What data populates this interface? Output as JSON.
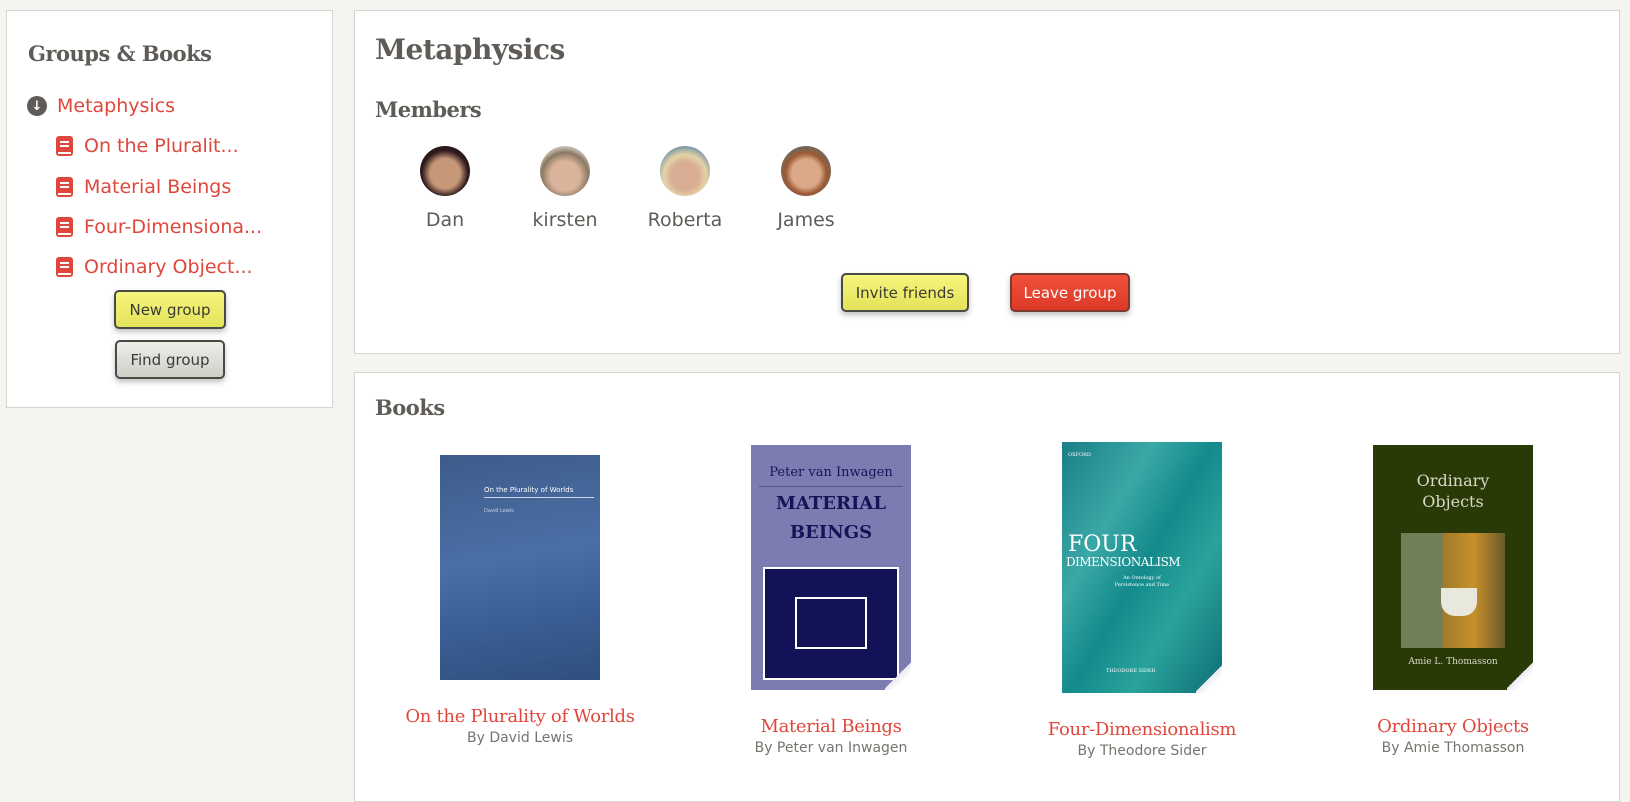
{
  "sidebar": {
    "title": "Groups & Books",
    "group": "Metaphysics",
    "books": [
      "On the Pluralit...",
      "Material Beings",
      "Four-Dimensiona...",
      "Ordinary Object..."
    ],
    "new_group": "New group",
    "find_group": "Find group"
  },
  "group": {
    "title": "Metaphysics",
    "members_heading": "Members",
    "members": [
      "Dan",
      "kirsten",
      "Roberta",
      "James"
    ],
    "invite": "Invite friends",
    "leave": "Leave group"
  },
  "books": {
    "heading": "Books",
    "items": [
      {
        "title": "On the Plurality of Worlds",
        "author": "By David Lewis",
        "cover": {
          "title": "On the Plurality of Worlds",
          "author": "David Lewis"
        }
      },
      {
        "title": "Material Beings",
        "author": "By Peter van Inwagen",
        "cover": {
          "author": "Peter van Inwagen",
          "title1": "MATERIAL",
          "title2": "BEINGS"
        }
      },
      {
        "title": "Four-Dimensionalism",
        "author": "By Theodore Sider",
        "cover": {
          "publisher": "OXFORD",
          "title1": "FOUR",
          "title2": "DIMENSIONALISM",
          "subtitle": "An Ontology of Persistence and Time",
          "author": "THEODORE SIDER"
        }
      },
      {
        "title": "Ordinary Objects",
        "author": "By Amie Thomasson",
        "cover": {
          "title1": "Ordinary",
          "title2": "Objects",
          "author": "Amie L. Thomasson"
        }
      }
    ]
  },
  "colors": {
    "accent": "#e0473c",
    "text": "#5f5b57"
  }
}
